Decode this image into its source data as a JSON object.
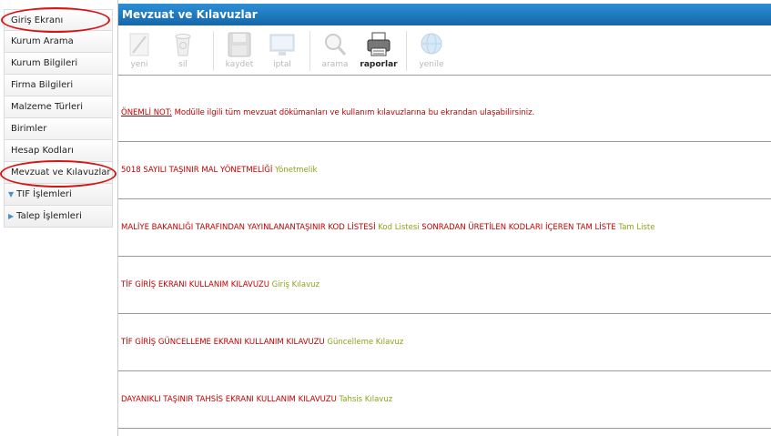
{
  "sidebar": {
    "items": [
      {
        "label": "Giriş Ekranı"
      },
      {
        "label": "Kurum Arama"
      },
      {
        "label": "Kurum Bilgileri"
      },
      {
        "label": "Firma Bilgileri"
      },
      {
        "label": "Malzeme Türleri"
      },
      {
        "label": "Birimler"
      },
      {
        "label": "Hesap Kodları"
      },
      {
        "label": "Mevzuat ve Kılavuzlar"
      }
    ],
    "groups": [
      {
        "label": "TIF İşlemleri"
      },
      {
        "label": "Talep İşlemleri"
      }
    ]
  },
  "header": {
    "title": "Mevzuat ve Kılavuzlar"
  },
  "toolbar": {
    "buttons": [
      {
        "label": "yeni",
        "icon": "pencil-icon"
      },
      {
        "label": "sil",
        "icon": "recycle-bin-icon"
      },
      {
        "label": "kaydet",
        "icon": "floppy-disk-icon"
      },
      {
        "label": "iptal",
        "icon": "monitor-icon"
      },
      {
        "label": "arama",
        "icon": "magnifier-icon"
      },
      {
        "label": "raporlar",
        "icon": "printer-icon"
      },
      {
        "label": "yenile",
        "icon": "globe-icon"
      }
    ]
  },
  "rows": {
    "note_label": "ÖNEMLİ NOT:",
    "note_text": " Modülle ilgili tüm mevzuat dökümanları ve kullanım kılavuzlarına bu ekrandan ulaşabilirsiniz.",
    "r2_text": "5018 SAYILI TAŞINIR MAL YÖNETMELİĞİ ",
    "r2_link": "Yönetmelik",
    "r3_text": "MALİYE BAKANLIĞI TARAFINDAN YAYINLANANTAŞINIR KOD LİSTESİ ",
    "r3_link": "Kod Listesi",
    "r3_text2": "   SONRADAN ÜRETİLEN KODLARI İÇEREN TAM LİSTE ",
    "r3_link2": "Tam Liste",
    "r4_text": "TİF GİRİŞ EKRANI KULLANIM KILAVUZU ",
    "r4_link": "Giriş Kılavuz",
    "r5_text": "TİF GİRİŞ GÜNCELLEME EKRANI KULLANIM KILAVUZU  ",
    "r5_link": "Güncelleme Kılavuz",
    "r6_text": "DAYANIKLI TAŞINIR TAHSİS EKRANI KULLANIM KILAVUZU ",
    "r6_link": "Tahsis Kılavuz"
  },
  "colors": {
    "title_bar": "#1a78c2",
    "text_red": "#c00000",
    "link_green": "#8aa51a",
    "highlight_circle": "#d81414"
  }
}
